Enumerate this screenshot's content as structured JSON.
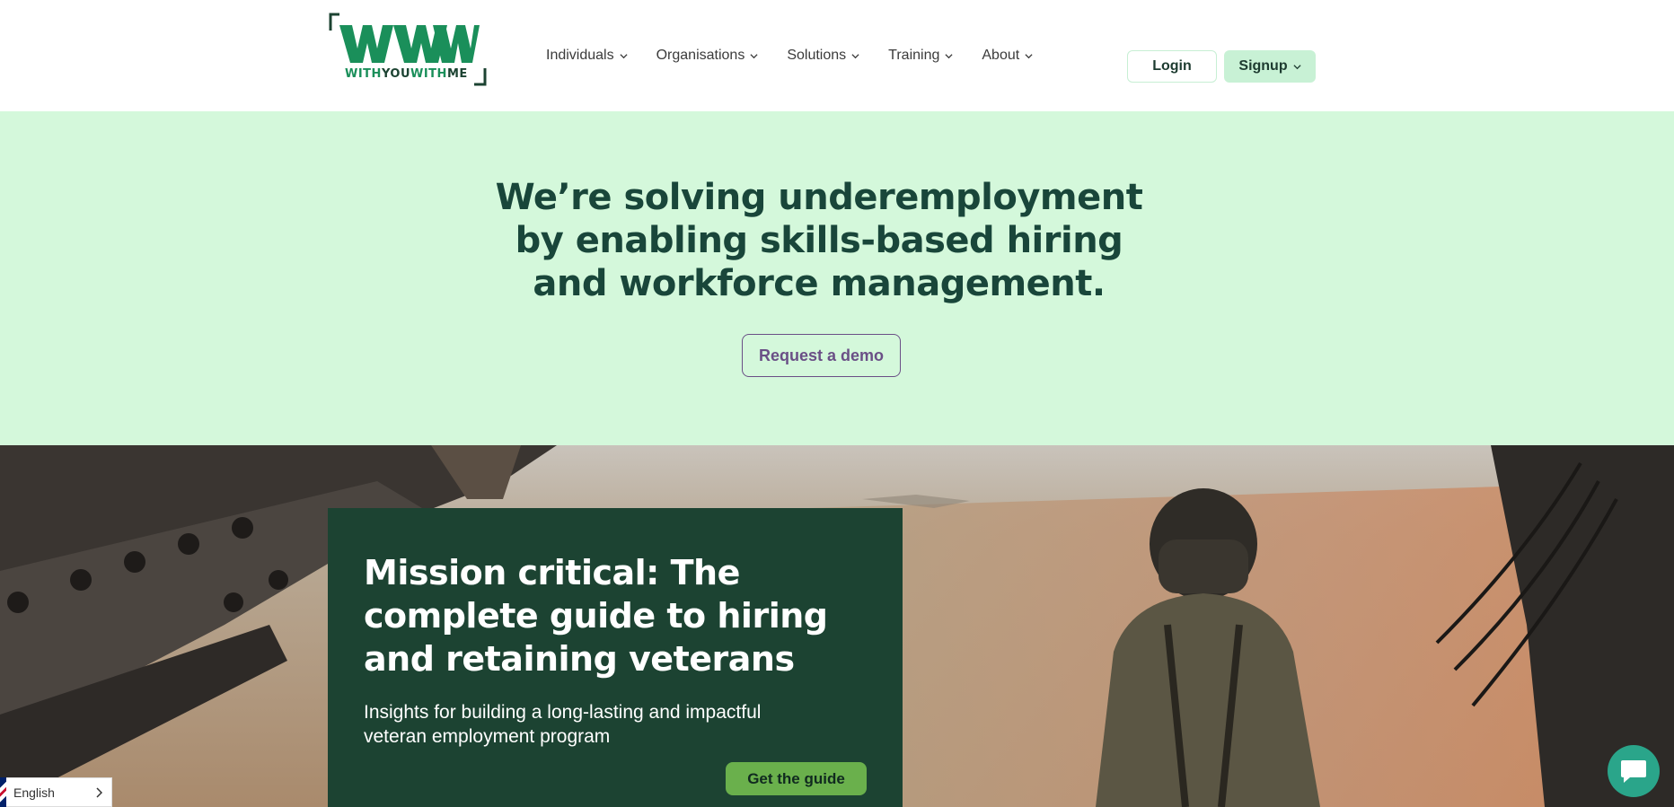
{
  "header": {
    "logo": {
      "mark": "WMM",
      "wordmark_parts": [
        "WITH",
        "YOU",
        "WITH",
        "ME"
      ]
    },
    "nav": [
      {
        "label": "Individuals",
        "icon": "chevron-down-icon"
      },
      {
        "label": "Organisations",
        "icon": "chevron-down-icon"
      },
      {
        "label": "Solutions",
        "icon": "chevron-down-icon"
      },
      {
        "label": "Training",
        "icon": "chevron-down-icon"
      },
      {
        "label": "About",
        "icon": "chevron-down-icon"
      }
    ],
    "login_label": "Login",
    "signup_label": "Signup"
  },
  "hero": {
    "title_lines": [
      "We’re solving underemployment",
      "by enabling skills-based hiring",
      "and workforce management."
    ],
    "cta_label": "Request a demo"
  },
  "banner": {
    "title_lines": [
      "Mission critical: The",
      "complete guide to hiring",
      "and retaining veterans"
    ],
    "subtitle_lines": [
      "Insights for building a long-lasting and impactful",
      "veteran employment program"
    ],
    "cta_label": "Get the guide"
  },
  "language": {
    "label": "English",
    "flag_icon": "uk-flag-icon",
    "arrow_icon": "chevron-right-icon"
  },
  "chat": {
    "icon": "chat-bubble-icon"
  },
  "colors": {
    "brand_green": "#1a8f5a",
    "dark_green": "#1c4332",
    "hero_bg": "#d4f8db",
    "demo_purple": "#6a4f86",
    "guide_button": "#6ab04c",
    "chat_teal": "#2aa58a"
  }
}
